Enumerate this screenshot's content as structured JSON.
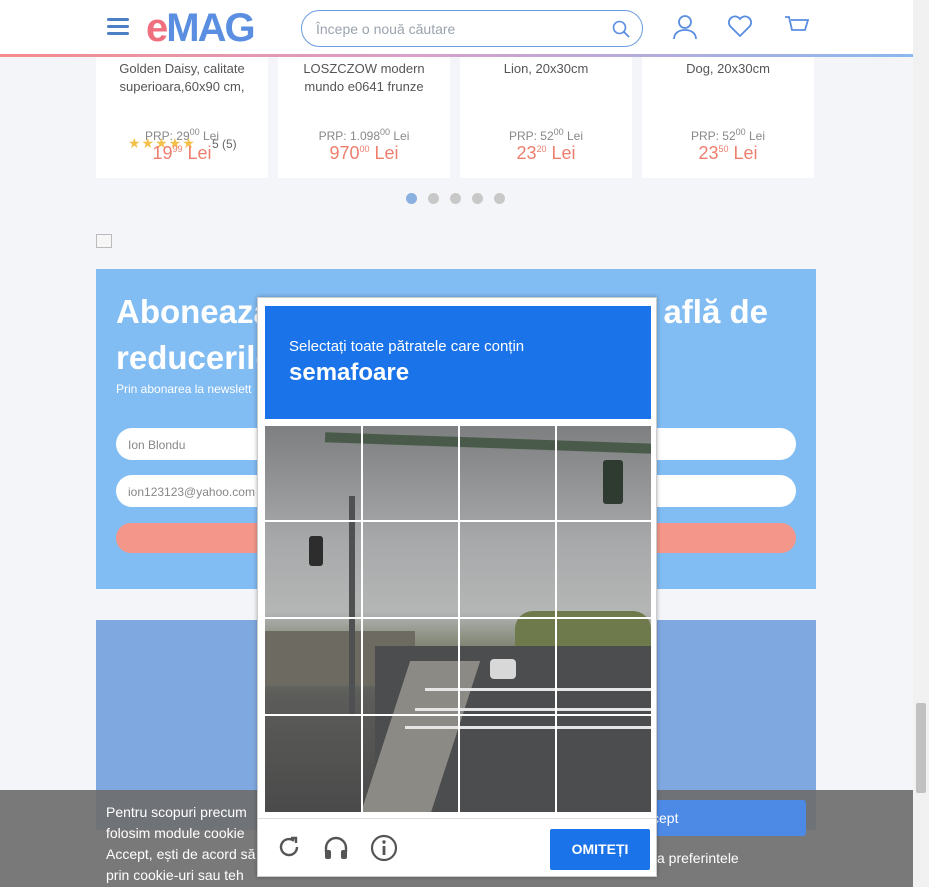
{
  "header": {
    "logo_text_e": "e",
    "logo_text_rest": "MAG",
    "search_placeholder": "Începe o nouă căutare"
  },
  "products": [
    {
      "name_line1": "Golden Daisy, calitate",
      "name_line2": "superioara,60x90 cm,",
      "stars": "★★★★★",
      "rating": "5 (5)",
      "prp": "PRP: 29",
      "prp_cents": "00",
      "prp_cur": " Lei",
      "price": "19",
      "price_cents": "99",
      "price_cur": " Lei"
    },
    {
      "name_line1": "LOSZCZOW modern",
      "name_line2": "mundo e0641 frunze",
      "prp": "PRP: 1.098",
      "prp_cents": "00",
      "prp_cur": " Lei",
      "price": "970",
      "price_cents": "00",
      "price_cur": " Lei"
    },
    {
      "name_line1": "Lion, 20x30cm",
      "prp": "PRP: 52",
      "prp_cents": "00",
      "prp_cur": " Lei",
      "price": "23",
      "price_cents": "20",
      "price_cur": " Lei"
    },
    {
      "name_line1": "Dog, 20x30cm",
      "prp": "PRP: 52",
      "prp_cents": "00",
      "prp_cur": " Lei",
      "price": "23",
      "price_cents": "50",
      "price_cur": " Lei"
    }
  ],
  "newsletter": {
    "title_left": "Abonează",
    "title_right": "află de",
    "title_line2": "reducerile",
    "subtitle": "Prin abonarea la newslett",
    "name_value": "Ion Blondu",
    "email_value": "ion123123@yahoo.com"
  },
  "cookie": {
    "line1": "Pentru scopuri precum",
    "line2": "folosim module cookie",
    "line3": "Accept, ești de acord să",
    "line4": "prin cookie-uri sau teh",
    "accept_label": "ccept",
    "pref_label": "za preferintele"
  },
  "captcha": {
    "instruction": "Selectați toate pătratele care conțin",
    "target": "semafoare",
    "skip_label": "OMITEȚI",
    "colors": {
      "header": "#1a73e8"
    }
  }
}
